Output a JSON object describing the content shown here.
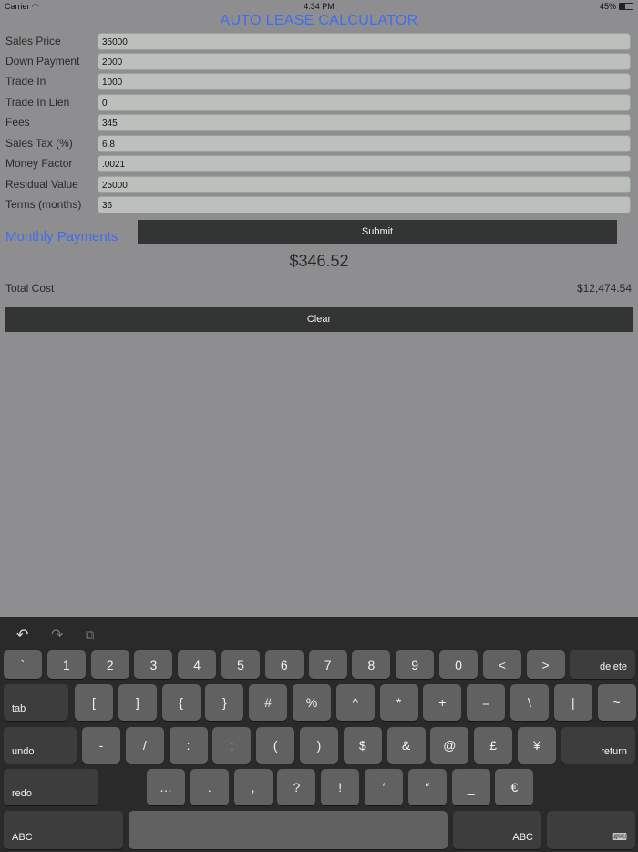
{
  "status": {
    "carrier": "Carrier",
    "time": "4:34 PM",
    "battery": "45%",
    "battery_level": 0.45
  },
  "app": {
    "title": "AUTO LEASE CALCULATOR"
  },
  "fields": [
    {
      "label": "Sales Price",
      "value": "35000"
    },
    {
      "label": "Down Payment",
      "value": "2000"
    },
    {
      "label": "Trade In",
      "value": "1000"
    },
    {
      "label": "Trade In Lien",
      "value": "0"
    },
    {
      "label": "Fees",
      "value": "345"
    },
    {
      "label": "Sales Tax (%)",
      "value": "6.8"
    },
    {
      "label": "Money Factor",
      "value": ".0021"
    },
    {
      "label": "Residual Value",
      "value": "25000"
    },
    {
      "label": "Terms (months)",
      "value": "36"
    }
  ],
  "results": {
    "monthly_label": "Monthly Payments",
    "submit_label": "Submit",
    "monthly_payment": "$346.52",
    "total_label": "Total Cost",
    "total_value": "$12,474.54",
    "clear_label": "Clear"
  },
  "keyboard": {
    "toolbar": {
      "undo": "↶",
      "redo": "↷",
      "paste": "⧉"
    },
    "row1": [
      "`",
      "1",
      "2",
      "3",
      "4",
      "5",
      "6",
      "7",
      "8",
      "9",
      "0",
      "<",
      ">"
    ],
    "delete": "delete",
    "tab": "tab",
    "row2": [
      "[",
      "]",
      "{",
      "}",
      "#",
      "%",
      "^",
      "*",
      "+",
      "=",
      "\\",
      "|",
      "~"
    ],
    "undo": "undo",
    "row3": [
      "-",
      "/",
      ":",
      ";",
      "(",
      ")",
      "$",
      "&",
      "@",
      "£",
      "¥"
    ],
    "return": "return",
    "redo": "redo",
    "row4": [
      "…",
      ".",
      ",",
      "?",
      "!",
      "′",
      "″",
      "_",
      "€"
    ],
    "abc": "ABC",
    "hide": "⌨"
  }
}
